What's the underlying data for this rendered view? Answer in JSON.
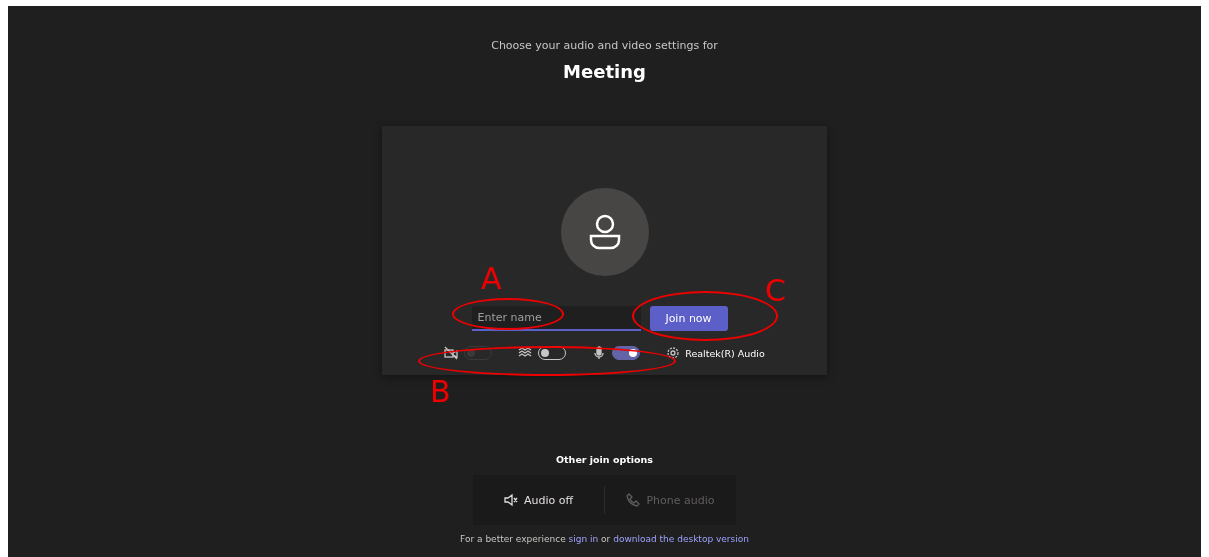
{
  "header": {
    "subtitle": "Choose your audio and video settings for",
    "title": "Meeting"
  },
  "name_field": {
    "placeholder": "Enter name"
  },
  "join_button": "Join now",
  "toggles": [
    {
      "kind": "camera",
      "on": false,
      "disabled": true
    },
    {
      "kind": "background",
      "on": false,
      "disabled": false
    },
    {
      "kind": "mic",
      "on": true,
      "disabled": false
    }
  ],
  "audio_device": "Realtek(R) Audio",
  "other_options": {
    "title": "Other join options",
    "options": [
      {
        "kind": "audio_off",
        "label": "Audio off",
        "disabled": false
      },
      {
        "kind": "phone",
        "label": "Phone audio",
        "disabled": true
      }
    ]
  },
  "footer": {
    "text": "For a better experience",
    "link_1": "sign in",
    "middle": "or",
    "link_2": "download the desktop version"
  },
  "annotations": [
    {
      "label": "A"
    },
    {
      "label": "B"
    },
    {
      "label": "C"
    }
  ]
}
